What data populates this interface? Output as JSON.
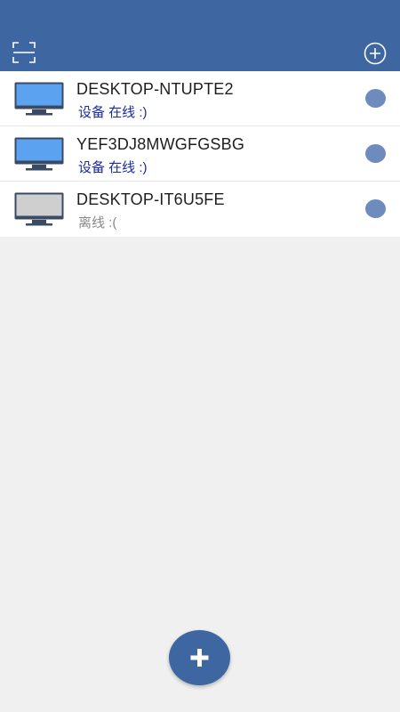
{
  "header": {
    "scan_icon": "scan-frame-icon",
    "add_icon": "circle-plus-icon",
    "background_color": "#3e67a1"
  },
  "devices": [
    {
      "name": "DESKTOP-NTUPTE2",
      "status": "设备 在线 :)",
      "state": "online",
      "monitor_color": "#5ba3f0"
    },
    {
      "name": "YEF3DJ8MWGFGSBG",
      "status": "设备 在线 :)",
      "state": "online",
      "monitor_color": "#5ba3f0"
    },
    {
      "name": "DESKTOP-IT6U5FE",
      "status": "离线 :(",
      "state": "offline",
      "monitor_color": "#cfcfcf"
    }
  ],
  "fab": {
    "icon": "plus-icon",
    "color": "#3e67a1"
  },
  "colors": {
    "online_text": "#1a2aa0",
    "offline_text": "#8a8a8a",
    "status_dot": "#6d8bbd"
  }
}
